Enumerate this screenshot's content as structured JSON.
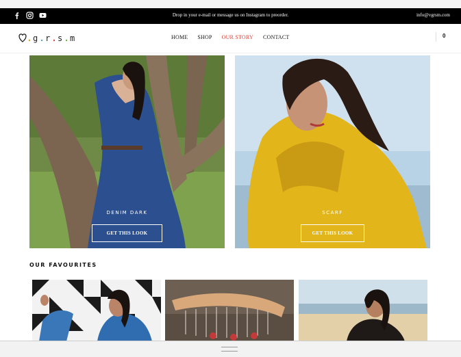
{
  "topbar": {
    "message": "Drop in your e-mail or message us on Instagram to preorder.",
    "email": "info@vgrsm.com",
    "social_icons": [
      "facebook-icon",
      "instagram-icon",
      "youtube-icon"
    ]
  },
  "nav": {
    "logo": "v.g.r.s.m",
    "menu": [
      "HOME",
      "SHOP",
      "OUR STORY",
      "CONTACT"
    ],
    "active_item": "OUR STORY",
    "cart_count": "0"
  },
  "hero": [
    {
      "title": "DENIM DARK",
      "cta": "GET THIS LOOK"
    },
    {
      "title": "SCARF",
      "cta": "GET THIS LOOK"
    }
  ],
  "favourites": {
    "title": "OUR FAVOURITES"
  },
  "colors": {
    "topbar_bg": "#000000",
    "accent": "#d9473d"
  }
}
